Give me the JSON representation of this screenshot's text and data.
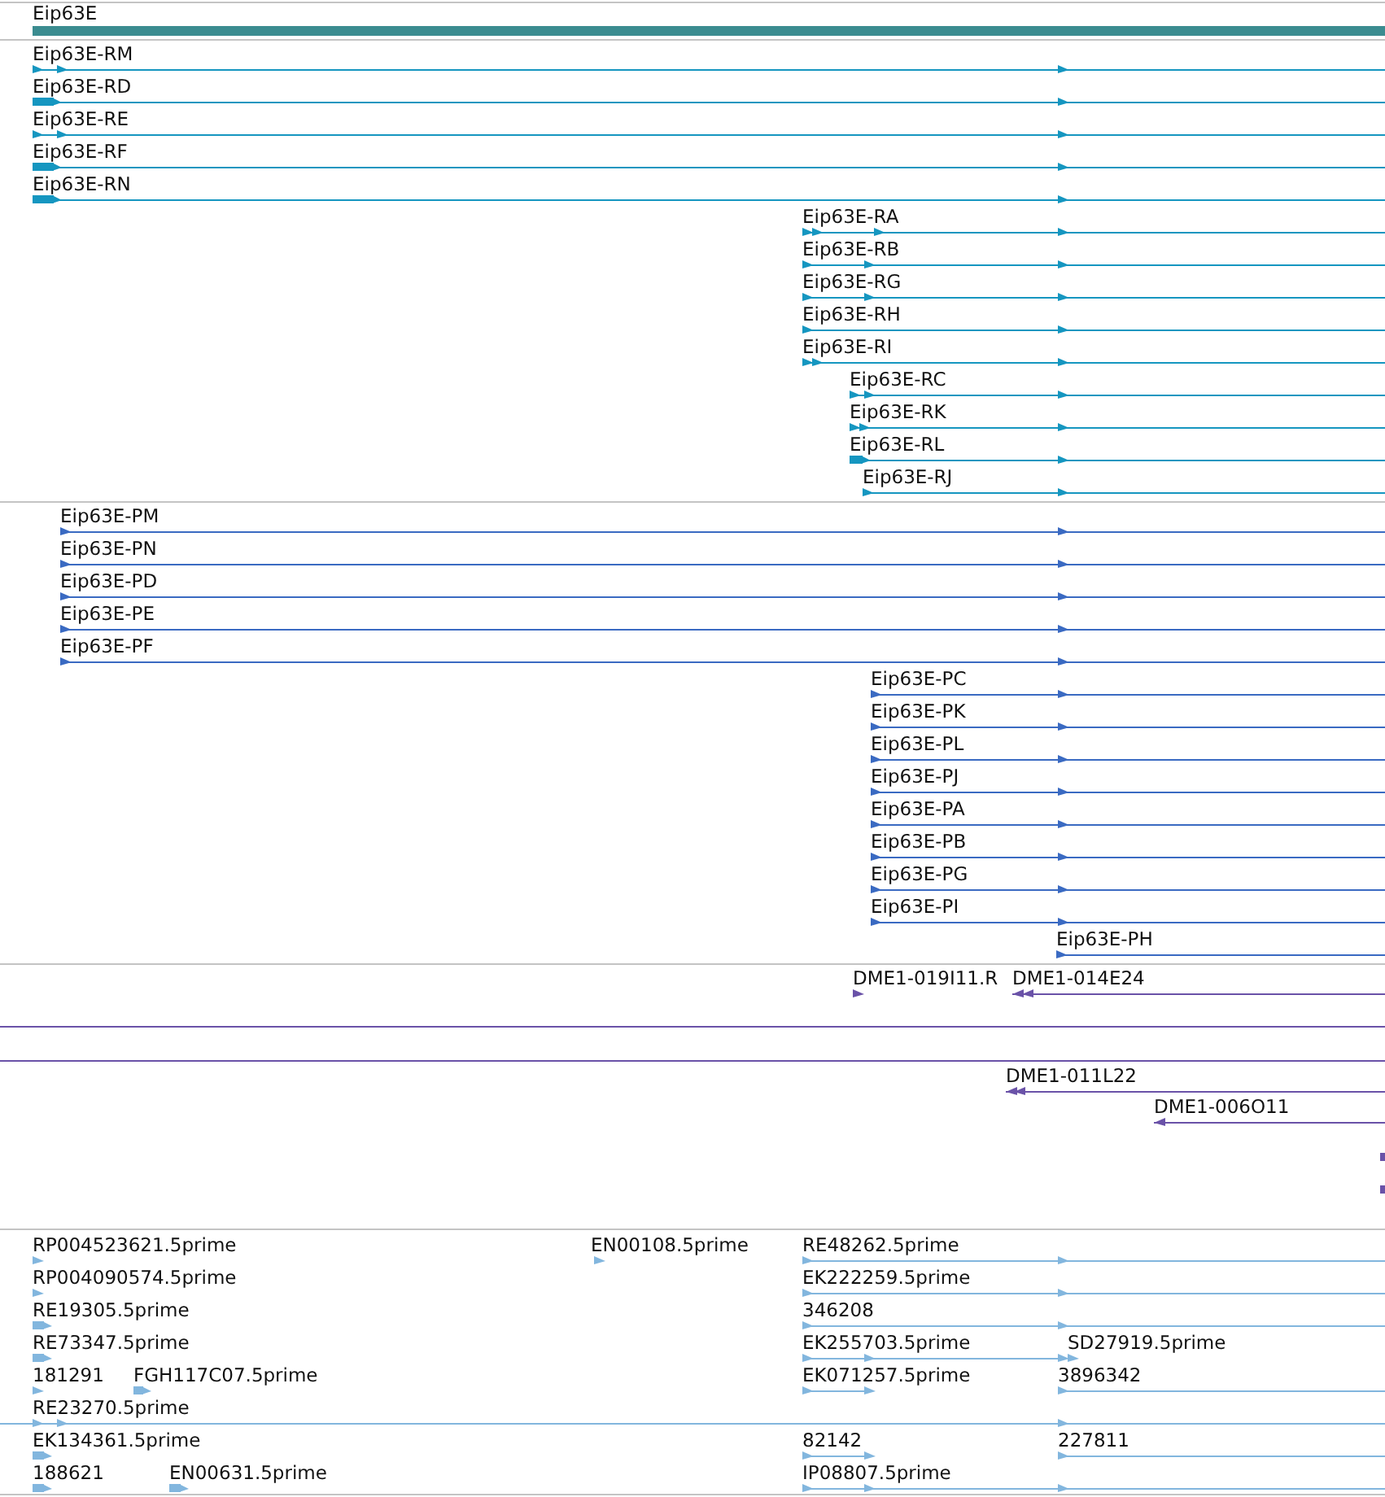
{
  "tracks": [
    {
      "kind": "gene",
      "features": [
        {
          "label": "Eip63E"
        }
      ]
    },
    {
      "kind": "transcript",
      "features": [
        {
          "label": "Eip63E-RM"
        },
        {
          "label": "Eip63E-RD"
        },
        {
          "label": "Eip63E-RE"
        },
        {
          "label": "Eip63E-RF"
        },
        {
          "label": "Eip63E-RN"
        },
        {
          "label": "Eip63E-RA"
        },
        {
          "label": "Eip63E-RB"
        },
        {
          "label": "Eip63E-RG"
        },
        {
          "label": "Eip63E-RH"
        },
        {
          "label": "Eip63E-RI"
        },
        {
          "label": "Eip63E-RC"
        },
        {
          "label": "Eip63E-RK"
        },
        {
          "label": "Eip63E-RL"
        },
        {
          "label": "Eip63E-RJ"
        }
      ]
    },
    {
      "kind": "protein",
      "features": [
        {
          "label": "Eip63E-PM"
        },
        {
          "label": "Eip63E-PN"
        },
        {
          "label": "Eip63E-PD"
        },
        {
          "label": "Eip63E-PE"
        },
        {
          "label": "Eip63E-PF"
        },
        {
          "label": "Eip63E-PC"
        },
        {
          "label": "Eip63E-PK"
        },
        {
          "label": "Eip63E-PL"
        },
        {
          "label": "Eip63E-PJ"
        },
        {
          "label": "Eip63E-PA"
        },
        {
          "label": "Eip63E-PB"
        },
        {
          "label": "Eip63E-PG"
        },
        {
          "label": "Eip63E-PI"
        },
        {
          "label": "Eip63E-PH"
        }
      ]
    },
    {
      "kind": "clone",
      "features": [
        {
          "label": "DME1-019I11.R"
        },
        {
          "label": "DME1-014E24"
        },
        {
          "label": "DME1-011L22"
        },
        {
          "label": "DME1-006O11"
        }
      ]
    },
    {
      "kind": "est",
      "features": [
        {
          "label": "RP004523621.5prime"
        },
        {
          "label": "EN00108.5prime"
        },
        {
          "label": "RE48262.5prime"
        },
        {
          "label": "RP004090574.5prime"
        },
        {
          "label": "EK222259.5prime"
        },
        {
          "label": "RE19305.5prime"
        },
        {
          "label": "346208"
        },
        {
          "label": "RE73347.5prime"
        },
        {
          "label": "EK255703.5prime"
        },
        {
          "label": "SD27919.5prime"
        },
        {
          "label": "181291"
        },
        {
          "label": "FGH117C07.5prime"
        },
        {
          "label": "EK071257.5prime"
        },
        {
          "label": "3896342"
        },
        {
          "label": "RE23270.5prime"
        },
        {
          "label": "EK134361.5prime"
        },
        {
          "label": "82142"
        },
        {
          "label": "227811"
        },
        {
          "label": "188621"
        },
        {
          "label": "EN00631.5prime"
        },
        {
          "label": "IP08807.5prime"
        }
      ]
    }
  ]
}
